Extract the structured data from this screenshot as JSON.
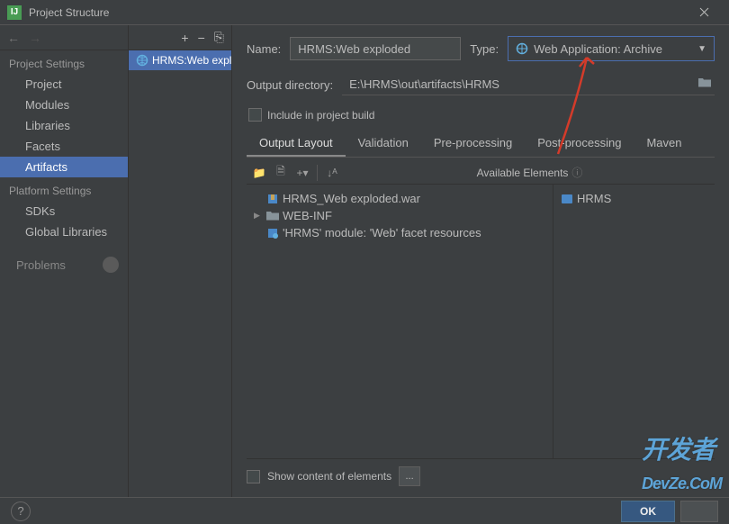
{
  "window": {
    "title": "Project Structure"
  },
  "sidebar": {
    "project_settings_header": "Project Settings",
    "platform_settings_header": "Platform Settings",
    "items": {
      "project": "Project",
      "modules": "Modules",
      "libraries": "Libraries",
      "facets": "Facets",
      "artifacts": "Artifacts",
      "sdks": "SDKs",
      "global_libraries": "Global Libraries",
      "problems": "Problems"
    }
  },
  "artifact_list": {
    "selected": "HRMS:Web exploded"
  },
  "form": {
    "name_label": "Name:",
    "name_value": "HRMS:Web exploded",
    "type_label": "Type:",
    "type_value": "Web Application: Archive",
    "output_dir_label": "Output directory:",
    "output_dir_value": "E:\\HRMS\\out\\artifacts\\HRMS",
    "include_label": "Include in project build"
  },
  "tabs": {
    "output_layout": "Output Layout",
    "validation": "Validation",
    "pre_processing": "Pre-processing",
    "post_processing": "Post-processing",
    "maven": "Maven"
  },
  "output_tree": {
    "available_header": "Available Elements",
    "node1": "HRMS_Web exploded.war",
    "node2": "WEB-INF",
    "node3": "'HRMS' module: 'Web' facet resources",
    "available_node": "HRMS"
  },
  "bottom": {
    "show_content_label": "Show content of elements",
    "dots": "..."
  },
  "footer": {
    "ok": "OK"
  },
  "watermark": "开发者\nDevZe.CoM"
}
